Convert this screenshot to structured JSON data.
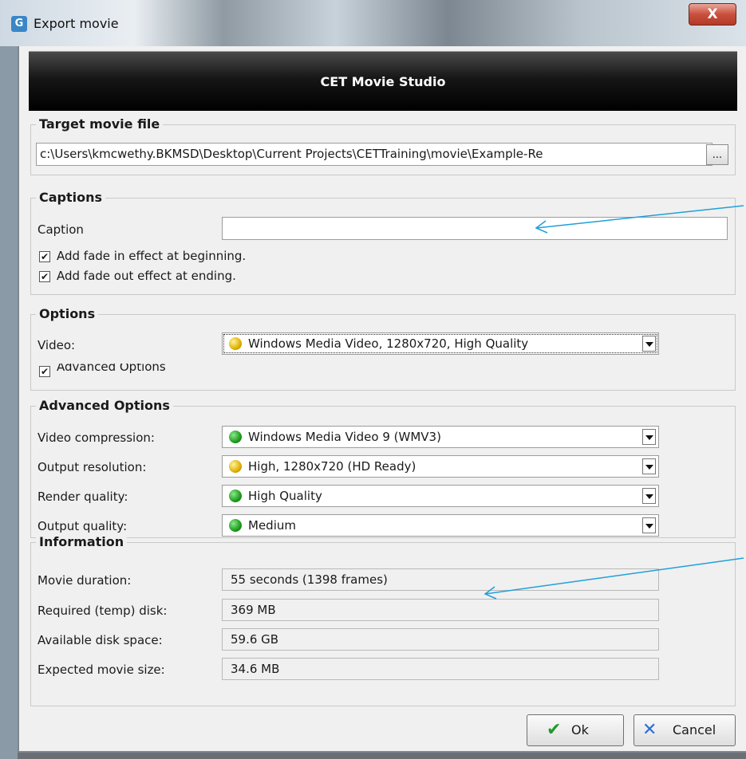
{
  "window": {
    "title": "Export movie",
    "close_symbol": "X",
    "app_icon_letter": "G"
  },
  "header": {
    "title": "CET Movie Studio"
  },
  "target": {
    "legend": "Target movie file",
    "path": "c:\\Users\\kmcwethy.BKMSD\\Desktop\\Current Projects\\CETTraining\\movie\\Example-Re",
    "browse_label": "..."
  },
  "captions": {
    "legend": "Captions",
    "caption_label": "Caption",
    "caption_value": "",
    "fade_in_label": "Add fade in effect at beginning.",
    "fade_out_label": "Add fade out effect at ending.",
    "fade_in_checked": true,
    "fade_out_checked": true
  },
  "options": {
    "legend": "Options",
    "video_label": "Video:",
    "video_value": "Windows Media Video, 1280x720, High Quality",
    "video_status": "yellow",
    "advanced_label": "Advanced Options",
    "advanced_checked": true
  },
  "advanced": {
    "legend": "Advanced Options",
    "compression_label": "Video compression:",
    "compression_value": "Windows Media Video 9 (WMV3)",
    "compression_status": "green",
    "resolution_label": "Output resolution:",
    "resolution_value": "High, 1280x720 (HD Ready)",
    "resolution_status": "yellow",
    "render_label": "Render quality:",
    "render_value": "High Quality",
    "render_status": "green",
    "output_label": "Output quality:",
    "output_value": "Medium",
    "output_status": "green"
  },
  "information": {
    "legend": "Information",
    "duration_label": "Movie duration:",
    "duration_value": "55 seconds (1398 frames)",
    "temp_label": "Required (temp) disk:",
    "temp_value": "369 MB",
    "available_label": "Available disk space:",
    "available_value": "59.6 GB",
    "expected_label": "Expected movie size:",
    "expected_value": "34.6 MB"
  },
  "buttons": {
    "ok_label": "Ok",
    "cancel_label": "Cancel"
  },
  "colors": {
    "annotation_arrow": "#1fa0d8",
    "status_green": "#1e9b1e",
    "status_yellow": "#e0b000"
  }
}
